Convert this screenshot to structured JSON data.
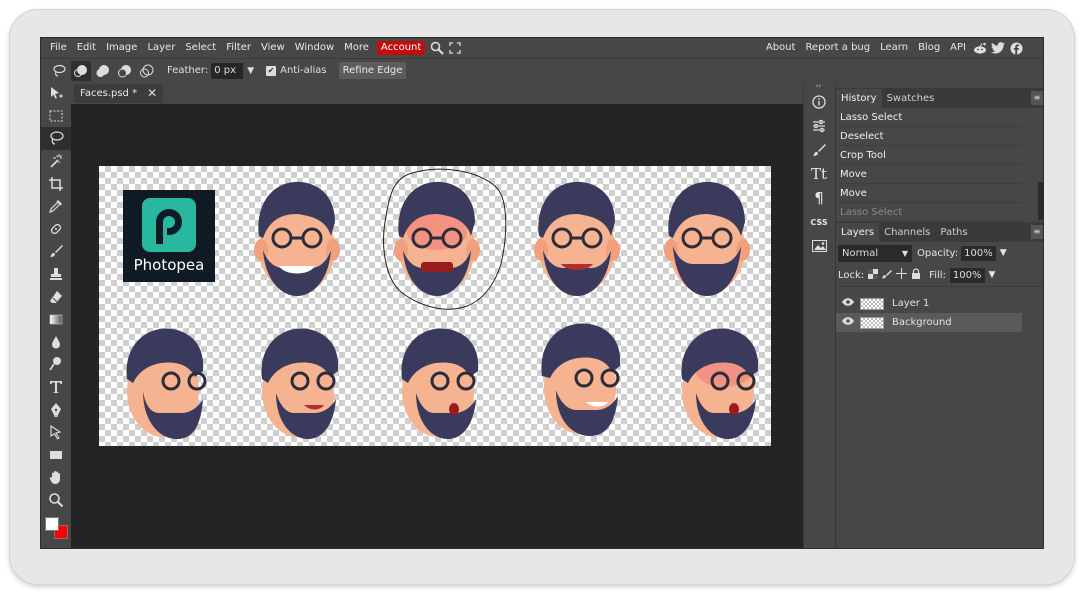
{
  "menu": {
    "items": [
      "File",
      "Edit",
      "Image",
      "Layer",
      "Select",
      "Filter",
      "View",
      "Window",
      "More"
    ],
    "account": "Account",
    "right": [
      "About",
      "Report a bug",
      "Learn",
      "Blog",
      "API"
    ]
  },
  "options": {
    "feather_label": "Feather:",
    "feather_value": "0 px",
    "antialias_label": "Anti-alias",
    "refine_label": "Refine Edge"
  },
  "document": {
    "tab_title": "Faces.psd *"
  },
  "canvas": {
    "logo_text": "Photopea"
  },
  "history": {
    "tabs": [
      "History",
      "Swatches"
    ],
    "items": [
      {
        "label": "Lasso Select",
        "dim": false
      },
      {
        "label": "Deselect",
        "dim": false
      },
      {
        "label": "Crop Tool",
        "dim": false
      },
      {
        "label": "Move",
        "dim": false
      },
      {
        "label": "Move",
        "dim": false
      },
      {
        "label": "Lasso Select",
        "dim": true
      }
    ]
  },
  "layers": {
    "tabs": [
      "Layers",
      "Channels",
      "Paths"
    ],
    "blend_mode": "Normal",
    "opacity_label": "Opacity:",
    "opacity_value": "100%",
    "lock_label": "Lock:",
    "fill_label": "Fill:",
    "fill_value": "100%",
    "items": [
      {
        "name": "Layer 1",
        "selected": false
      },
      {
        "name": "Background",
        "selected": true
      }
    ]
  },
  "colors": {
    "foreground": "#ffffff",
    "background": "#ff0000",
    "accent": "#c50c0c"
  }
}
